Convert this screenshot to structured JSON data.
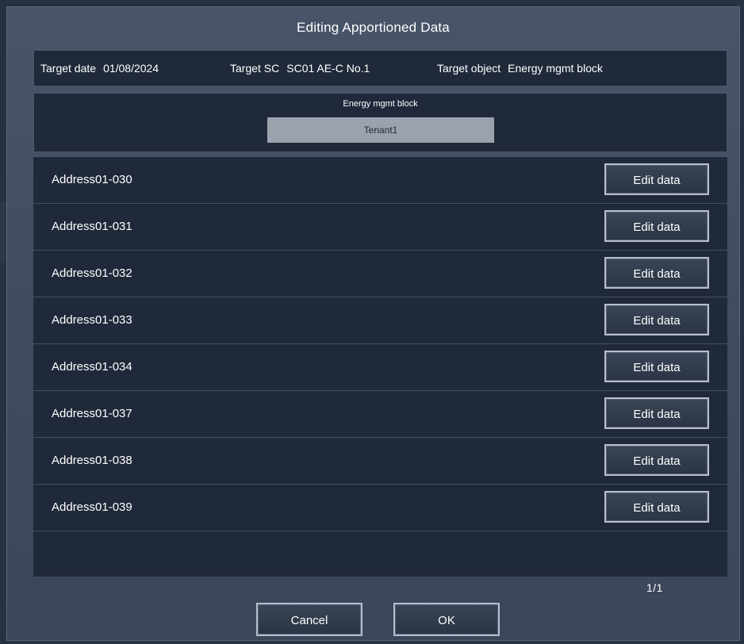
{
  "dialog": {
    "title": "Editing Apportioned Data"
  },
  "info": {
    "target_date_label": "Target date",
    "target_date_value": "01/08/2024",
    "target_sc_label": "Target SC",
    "target_sc_value": "SC01 AE-C No.1",
    "target_object_label": "Target object",
    "target_object_value": "Energy mgmt block"
  },
  "block": {
    "label": "Energy mgmt block",
    "value": "Tenant1"
  },
  "rows": [
    {
      "address": "Address01-030",
      "button": "Edit data"
    },
    {
      "address": "Address01-031",
      "button": "Edit data"
    },
    {
      "address": "Address01-032",
      "button": "Edit data"
    },
    {
      "address": "Address01-033",
      "button": "Edit data"
    },
    {
      "address": "Address01-034",
      "button": "Edit data"
    },
    {
      "address": "Address01-037",
      "button": "Edit data"
    },
    {
      "address": "Address01-038",
      "button": "Edit data"
    },
    {
      "address": "Address01-039",
      "button": "Edit data"
    }
  ],
  "pagination": {
    "text": "1/1"
  },
  "footer": {
    "cancel_label": "Cancel",
    "ok_label": "OK"
  },
  "colors": {
    "dialog_bg": "#434e62",
    "panel_bg": "#20293a",
    "field_bg": "#9aa2ad",
    "text": "#ffffff"
  }
}
